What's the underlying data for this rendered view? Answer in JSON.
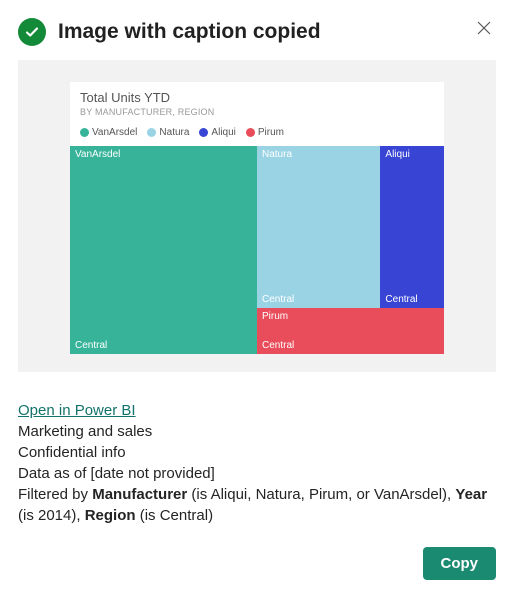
{
  "header": {
    "title": "Image with caption copied"
  },
  "chart_data": {
    "type": "treemap",
    "title": "Total Units YTD",
    "subtitle": "BY MANUFACTURER, REGION",
    "series": [
      {
        "name": "VanArsdel",
        "color": "#36b399",
        "region": "Central",
        "value": 50
      },
      {
        "name": "Natura",
        "color": "#9ad3e4",
        "region": "Central",
        "value": 26
      },
      {
        "name": "Aliqui",
        "color": "#3844d4",
        "region": "Central",
        "value": 13
      },
      {
        "name": "Pirum",
        "color": "#e94d5b",
        "region": "Central",
        "value": 11
      }
    ]
  },
  "caption": {
    "link_label": "Open in Power BI",
    "line1": "Marketing and sales",
    "line2": "Confidential info",
    "line3": "Data as of [date not provided]",
    "filter_prefix": "Filtered by ",
    "f1_label": "Manufacturer",
    "f1_val": " (is Aliqui, Natura, Pirum, or VanArsdel), ",
    "f2_label": "Year",
    "f2_val": " (is 2014), ",
    "f3_label": "Region",
    "f3_val": " (is Central)"
  },
  "footer": {
    "copy_label": "Copy"
  }
}
